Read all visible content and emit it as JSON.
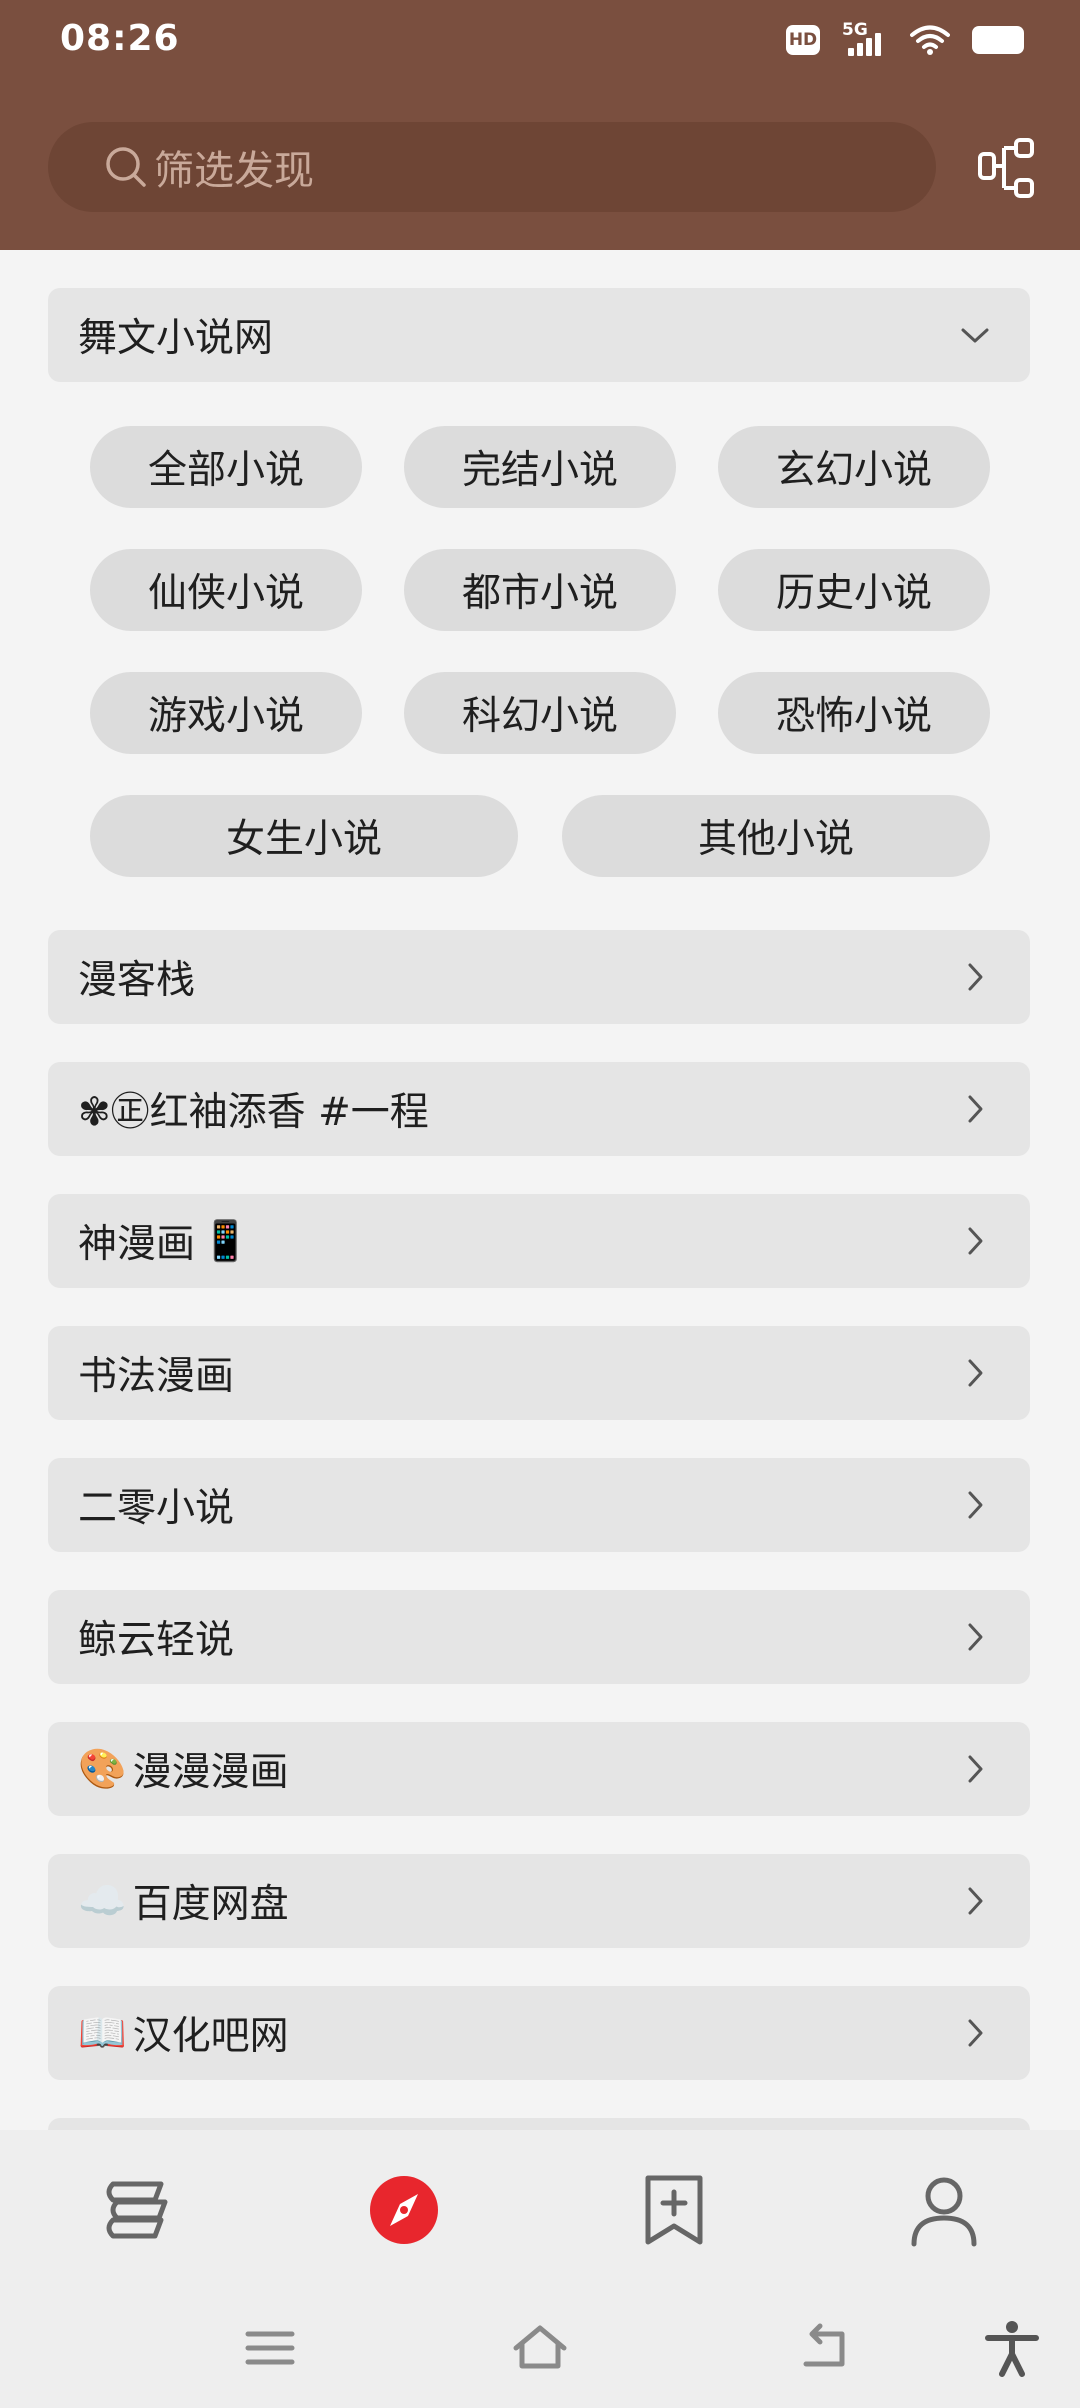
{
  "status_bar": {
    "time": "08:26",
    "hd": "HD",
    "network": "5G"
  },
  "search": {
    "placeholder": "筛选发现"
  },
  "expanded_group": {
    "title": "舞文小说网",
    "chips": [
      "全部小说",
      "完结小说",
      "玄幻小说",
      "仙侠小说",
      "都市小说",
      "历史小说",
      "游戏小说",
      "科幻小说",
      "恐怖小说",
      "女生小说",
      "其他小说"
    ]
  },
  "sources": [
    {
      "label": "漫客栈"
    },
    {
      "label": "✾㊣红袖添香 #一程"
    },
    {
      "label": "神漫画",
      "emoji": "📱",
      "emoji_after": true
    },
    {
      "label": "书法漫画"
    },
    {
      "label": "二零小说"
    },
    {
      "label": "鲸云轻说"
    },
    {
      "label": "漫漫漫画",
      "emoji": "🎨"
    },
    {
      "label": "百度网盘",
      "emoji": "☁️"
    },
    {
      "label": "汉化吧网",
      "emoji": "📖"
    }
  ],
  "colors": {
    "header": "#7a4f3f",
    "accent": "#e8262d"
  },
  "bottom_nav": {
    "items": [
      "bookshelf-icon",
      "explore-compass-icon",
      "bookmark-add-icon",
      "person-icon"
    ],
    "active": "explore-compass-icon"
  }
}
